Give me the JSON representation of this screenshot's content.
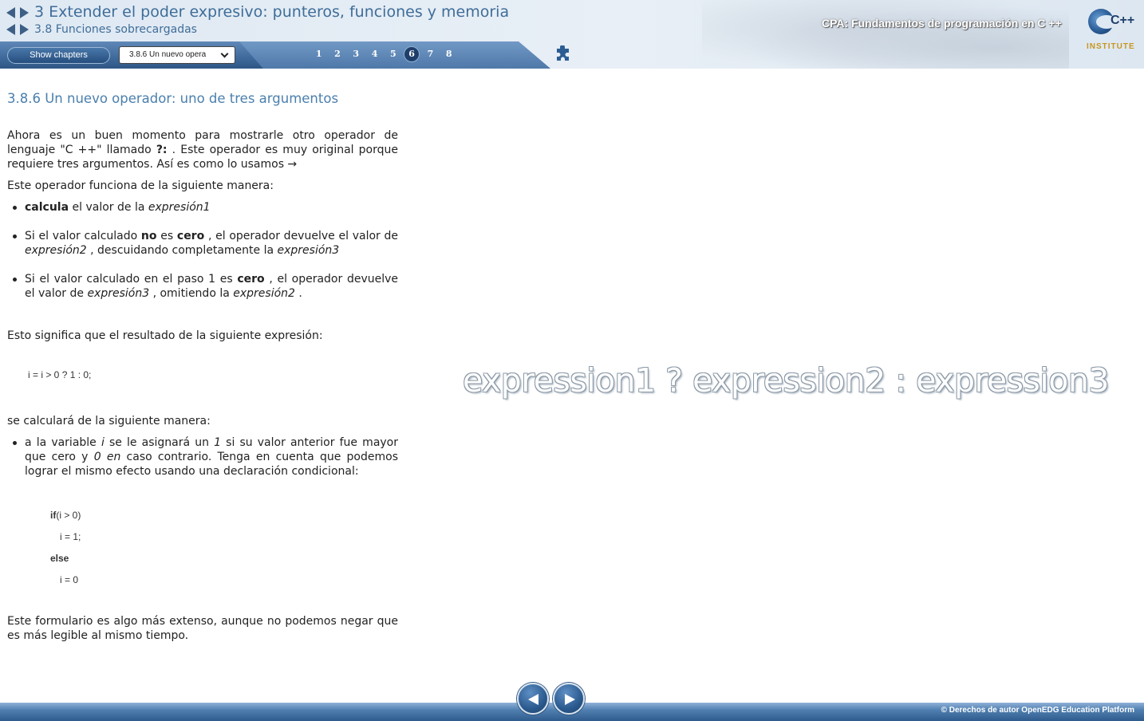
{
  "header": {
    "chapter_title": "3 Extender el poder expresivo: punteros, funciones y memoria",
    "section_title": "3.8 Funciones sobrecargadas",
    "course_title": "CPA: Fundamentos de programación en C ++",
    "logo": {
      "text": "C++",
      "subtext": "INSTITUTE"
    }
  },
  "toolbar": {
    "show_chapters_label": "Show chapters",
    "page_select_value": "3.8.6 Un nuevo opera",
    "pages": [
      "1",
      "2",
      "3",
      "4",
      "5",
      "6",
      "7",
      "8"
    ],
    "active_page": "6",
    "puzzle_icon": "puzzle-icon"
  },
  "content": {
    "heading": "3.8.6 Un nuevo operador: uno de tres argumentos",
    "intro": {
      "a": "Ahora es un buen momento para mostrarle otro operador de lenguaje \"C ++\" llamado ",
      "op": "?:",
      "b": " . Este operador es muy original porque requiere tres argumentos. Así es como lo usamos →"
    },
    "works": "Este operador funciona de la siguiente manera:",
    "list1": [
      {
        "b1": "calcula",
        "t1": " el valor de la ",
        "i1": "expresión1"
      },
      {
        "t1": "Si el valor calculado ",
        "b1": "no",
        "t2": " es ",
        "b2": "cero",
        "t3": " , el operador devuelve el valor de ",
        "i1": "expresión2",
        "t4": " , descuidando completamente la ",
        "i2": "expresión3"
      },
      {
        "t1": "Si el valor calculado en el paso 1 es ",
        "b1": "cero",
        "t2": " , el operador devuelve el valor de ",
        "i1": "expresión3",
        "t3": " , omitiendo la ",
        "i2": "expresión2",
        "t4": " ."
      }
    ],
    "meaning": "Esto significa que el resultado de la siguiente expresión:",
    "code_expr": "i = i > 0 ? 1 : 0;",
    "calc": "se calculará de la siguiente manera:",
    "list2": {
      "t1": "a la variable ",
      "i1": "i",
      "t2": " se le asignará un ",
      "i2": "1",
      "t3": " si su valor anterior fue mayor que cero y ",
      "i3": "0 en",
      "t4": " caso contrario. Tenga en cuenta que podemos lograr el mismo efecto usando una declaración condicional:"
    },
    "code_block": {
      "kw_if": "if",
      "cond": "(i > 0)",
      "line2": "i = 1;",
      "kw_else": "else",
      "line4": "i = 0"
    },
    "outro": "Este formulario es algo más extenso, aunque no podemos negar que es más legible al mismo tiempo.",
    "expression_image": "expression1 ? expression2 : expression3"
  },
  "footer": {
    "copyright": "© Derechos de autor OpenEDG Education Platform",
    "prev_icon": "triangle-left-icon",
    "next_icon": "triangle-right-icon"
  }
}
